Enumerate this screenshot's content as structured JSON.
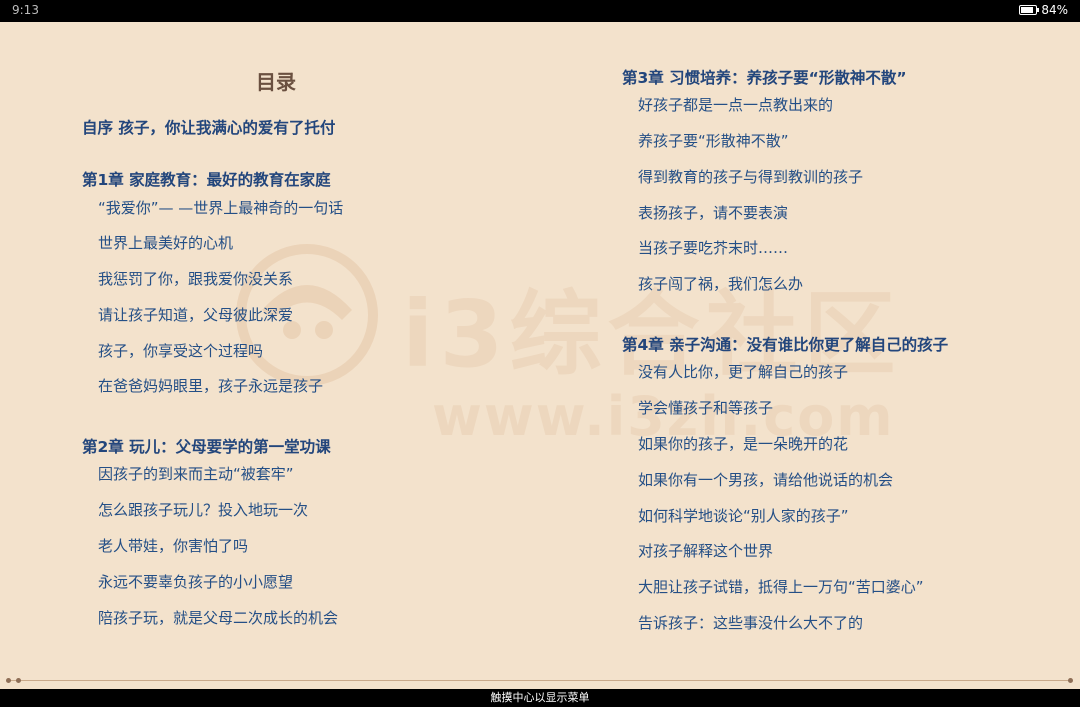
{
  "status_bar": {
    "time": "9:13",
    "battery": "84%"
  },
  "toc": {
    "title": "目录",
    "preface": "自序 孩子，你让我满心的爱有了托付",
    "chapters": [
      {
        "title": "第1章 家庭教育：最好的教育在家庭",
        "items": [
          "“我爱你”— —世界上最神奇的一句话",
          "世界上最美好的心机",
          "我惩罚了你，跟我爱你没关系",
          "请让孩子知道，父母彼此深爱",
          "孩子，你享受这个过程吗",
          "在爸爸妈妈眼里，孩子永远是孩子"
        ]
      },
      {
        "title": "第2章 玩儿：父母要学的第一堂功课",
        "items": [
          "因孩子的到来而主动“被套牢”",
          "怎么跟孩子玩儿？投入地玩一次",
          "老人带娃，你害怕了吗",
          "永远不要辜负孩子的小小愿望",
          "陪孩子玩，就是父母二次成长的机会"
        ]
      },
      {
        "title": "第3章 习惯培养：养孩子要“形散神不散”",
        "items": [
          "好孩子都是一点一点教出来的",
          "养孩子要“形散神不散”",
          "得到教育的孩子与得到教训的孩子",
          "表扬孩子，请不要表演",
          "当孩子要吃芥末时……",
          "孩子闯了祸，我们怎么办"
        ]
      },
      {
        "title": "第4章 亲子沟通：没有谁比你更了解自己的孩子",
        "items": [
          "没有人比你，更了解自己的孩子",
          "学会懂孩子和等孩子",
          "如果你的孩子，是一朵晚开的花",
          "如果你有一个男孩，请给他说话的机会",
          "如何科学地谈论“别人家的孩子”",
          "对孩子解释这个世界",
          "大胆让孩子试错，抵得上一万句“苦口婆心”",
          "告诉孩子：这些事没什么大不了的"
        ]
      }
    ]
  },
  "watermark": {
    "text": "i3综合社区",
    "url": "www.i3zh.com"
  },
  "bottom_bar": {
    "hint": "触摸中心以显示菜单"
  }
}
